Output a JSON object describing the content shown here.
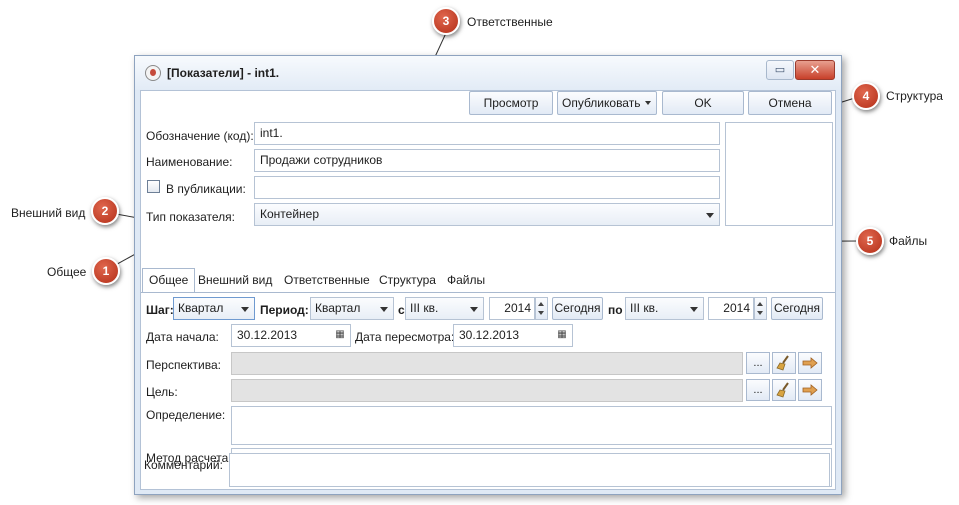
{
  "window": {
    "title": "[Показатели] - int1.",
    "restore_glyph": "▭",
    "close_glyph": "✕"
  },
  "toolbar": {
    "preview_label": "Просмотр",
    "publish_label": "Опубликовать",
    "ok_label": "OK",
    "cancel_label": "Отмена"
  },
  "form": {
    "code_label": "Обозначение (код):",
    "code_value": "int1.",
    "name_label": "Наименование:",
    "name_value": "Продажи сотрудников",
    "publish_label": "В публикации:",
    "publish_value": "",
    "type_label": "Тип показателя:",
    "type_value": "Контейнер"
  },
  "tabs": [
    {
      "label": "Общее"
    },
    {
      "label": "Внешний вид"
    },
    {
      "label": "Ответственные"
    },
    {
      "label": "Структура"
    },
    {
      "label": "Файлы"
    }
  ],
  "general": {
    "step_label": "Шаг:",
    "step_value": "Квартал",
    "period_label": "Период:",
    "period_value": "Квартал",
    "from_label": "с",
    "from_quarter": "III кв.",
    "from_year": "2014",
    "today1_label": "Сегодня",
    "to_label": "по",
    "to_quarter": "III кв.",
    "to_year": "2014",
    "today2_label": "Сегодня",
    "start_date_label": "Дата начала:",
    "start_date_value": "30.12.2013",
    "review_date_label": "Дата пересмотра:",
    "review_date_value": "30.12.2013",
    "perspective_label": "Перспектива:",
    "goal_label": "Цель:",
    "definition_label": "Определение:",
    "method_label": "Метод расчета:",
    "comment_label": "Комментарий:",
    "ellipsis_label": "..."
  },
  "callouts": [
    {
      "number": "1",
      "text": "Общее"
    },
    {
      "number": "2",
      "text": "Внешний вид"
    },
    {
      "number": "3",
      "text": "Ответственные"
    },
    {
      "number": "4",
      "text": "Структура"
    },
    {
      "number": "5",
      "text": "Файлы"
    }
  ],
  "colors": {
    "callout_badge": "#c0391f",
    "window_frame": "#dfe9f5",
    "close_button": "#c8402a"
  }
}
